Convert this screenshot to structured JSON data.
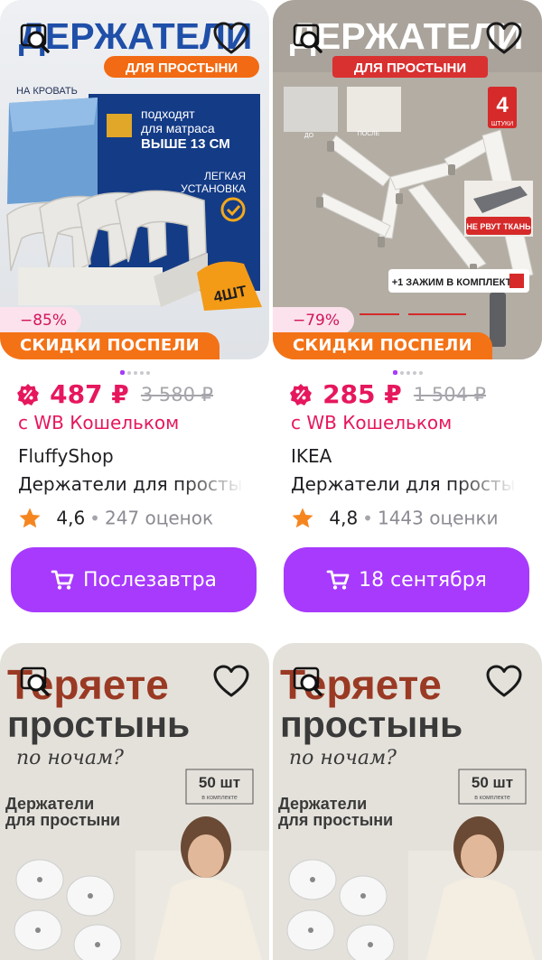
{
  "colors": {
    "accent": "#a73afd",
    "price": "#e6175e",
    "promo": "#f47216",
    "discount_bg": "#fbe2ec"
  },
  "products": [
    {
      "image": {
        "headline": "ДЕРЖАТЕЛИ",
        "badge": "ДЛЯ ПРОСТЫНИ",
        "sub": "НА КРОВАТЬ",
        "fit_l1": "подходят",
        "fit_l2": "для матраса",
        "fit_l3": "ВЫШЕ 13 СМ",
        "easy_l1": "ЛЕГКАЯ",
        "easy_l2": "УСТАНОВКА",
        "count": "4ШТ"
      },
      "discount": "−85%",
      "promo": "СКИДКИ ПОСПЕЛИ",
      "price": "487 ₽",
      "old_price": "3 580 ₽",
      "wallet": "с WB Кошельком",
      "brand": "FluffyShop",
      "title": "Держатели для простыни",
      "rating": "4,6",
      "reviews": "247 оценок",
      "delivery": "Послезавтра"
    },
    {
      "image": {
        "headline": "ДЕРЖАТЕЛИ",
        "badge": "ДЛЯ ПРОСТЫНИ",
        "count_num": "4",
        "count_unit": "ШТУКИ",
        "no_tear": "НЕ РВУТ ТКАНЬ",
        "clamp": "+1 ЗАЖИМ В КОМПЛЕКТ",
        "before": "ДО",
        "after": "ПОСЛЕ"
      },
      "discount": "−79%",
      "promo": "СКИДКИ ПОСПЕЛИ",
      "price": "285 ₽",
      "old_price": "1 504 ₽",
      "wallet": "с WB Кошельком",
      "brand": "IKEA",
      "title": "Держатели для простыни",
      "rating": "4,8",
      "reviews": "1443 оценки",
      "delivery": "18 сентября"
    },
    {
      "image": {
        "l1": "Теряете",
        "l2": "простынь",
        "l3": "по ночам?",
        "l4": "Держатели",
        "l5": "для простыни",
        "count": "50 шт",
        "count_sub": "в комплекте"
      }
    },
    {
      "image": {
        "l1": "Теряете",
        "l2": "простынь",
        "l3": "по ночам?",
        "l4": "Держатели",
        "l5": "для простыни",
        "count": "50 шт",
        "count_sub": "в комплекте"
      }
    }
  ],
  "icons": [
    "zoom-icon",
    "heart-icon",
    "wb-wallet-icon",
    "star-icon",
    "cart-icon"
  ]
}
